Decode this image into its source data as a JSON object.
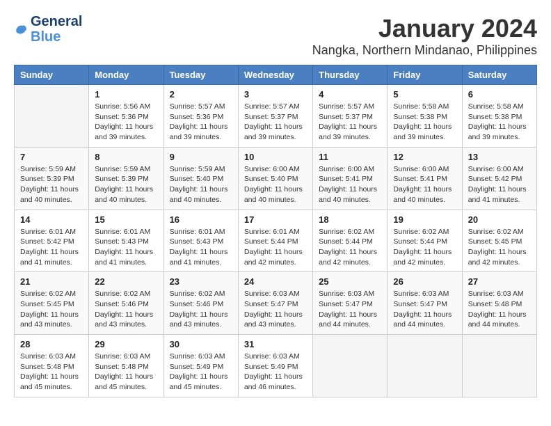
{
  "header": {
    "logo_line1": "General",
    "logo_line2": "Blue",
    "title": "January 2024",
    "subtitle": "Nangka, Northern Mindanao, Philippines"
  },
  "calendar": {
    "days_of_week": [
      "Sunday",
      "Monday",
      "Tuesday",
      "Wednesday",
      "Thursday",
      "Friday",
      "Saturday"
    ],
    "weeks": [
      [
        {
          "day": "",
          "info": ""
        },
        {
          "day": "1",
          "info": "Sunrise: 5:56 AM\nSunset: 5:36 PM\nDaylight: 11 hours\nand 39 minutes."
        },
        {
          "day": "2",
          "info": "Sunrise: 5:57 AM\nSunset: 5:36 PM\nDaylight: 11 hours\nand 39 minutes."
        },
        {
          "day": "3",
          "info": "Sunrise: 5:57 AM\nSunset: 5:37 PM\nDaylight: 11 hours\nand 39 minutes."
        },
        {
          "day": "4",
          "info": "Sunrise: 5:57 AM\nSunset: 5:37 PM\nDaylight: 11 hours\nand 39 minutes."
        },
        {
          "day": "5",
          "info": "Sunrise: 5:58 AM\nSunset: 5:38 PM\nDaylight: 11 hours\nand 39 minutes."
        },
        {
          "day": "6",
          "info": "Sunrise: 5:58 AM\nSunset: 5:38 PM\nDaylight: 11 hours\nand 39 minutes."
        }
      ],
      [
        {
          "day": "7",
          "info": "Sunrise: 5:59 AM\nSunset: 5:39 PM\nDaylight: 11 hours\nand 40 minutes."
        },
        {
          "day": "8",
          "info": "Sunrise: 5:59 AM\nSunset: 5:39 PM\nDaylight: 11 hours\nand 40 minutes."
        },
        {
          "day": "9",
          "info": "Sunrise: 5:59 AM\nSunset: 5:40 PM\nDaylight: 11 hours\nand 40 minutes."
        },
        {
          "day": "10",
          "info": "Sunrise: 6:00 AM\nSunset: 5:40 PM\nDaylight: 11 hours\nand 40 minutes."
        },
        {
          "day": "11",
          "info": "Sunrise: 6:00 AM\nSunset: 5:41 PM\nDaylight: 11 hours\nand 40 minutes."
        },
        {
          "day": "12",
          "info": "Sunrise: 6:00 AM\nSunset: 5:41 PM\nDaylight: 11 hours\nand 40 minutes."
        },
        {
          "day": "13",
          "info": "Sunrise: 6:00 AM\nSunset: 5:42 PM\nDaylight: 11 hours\nand 41 minutes."
        }
      ],
      [
        {
          "day": "14",
          "info": "Sunrise: 6:01 AM\nSunset: 5:42 PM\nDaylight: 11 hours\nand 41 minutes."
        },
        {
          "day": "15",
          "info": "Sunrise: 6:01 AM\nSunset: 5:43 PM\nDaylight: 11 hours\nand 41 minutes."
        },
        {
          "day": "16",
          "info": "Sunrise: 6:01 AM\nSunset: 5:43 PM\nDaylight: 11 hours\nand 41 minutes."
        },
        {
          "day": "17",
          "info": "Sunrise: 6:01 AM\nSunset: 5:44 PM\nDaylight: 11 hours\nand 42 minutes."
        },
        {
          "day": "18",
          "info": "Sunrise: 6:02 AM\nSunset: 5:44 PM\nDaylight: 11 hours\nand 42 minutes."
        },
        {
          "day": "19",
          "info": "Sunrise: 6:02 AM\nSunset: 5:44 PM\nDaylight: 11 hours\nand 42 minutes."
        },
        {
          "day": "20",
          "info": "Sunrise: 6:02 AM\nSunset: 5:45 PM\nDaylight: 11 hours\nand 42 minutes."
        }
      ],
      [
        {
          "day": "21",
          "info": "Sunrise: 6:02 AM\nSunset: 5:45 PM\nDaylight: 11 hours\nand 43 minutes."
        },
        {
          "day": "22",
          "info": "Sunrise: 6:02 AM\nSunset: 5:46 PM\nDaylight: 11 hours\nand 43 minutes."
        },
        {
          "day": "23",
          "info": "Sunrise: 6:02 AM\nSunset: 5:46 PM\nDaylight: 11 hours\nand 43 minutes."
        },
        {
          "day": "24",
          "info": "Sunrise: 6:03 AM\nSunset: 5:47 PM\nDaylight: 11 hours\nand 43 minutes."
        },
        {
          "day": "25",
          "info": "Sunrise: 6:03 AM\nSunset: 5:47 PM\nDaylight: 11 hours\nand 44 minutes."
        },
        {
          "day": "26",
          "info": "Sunrise: 6:03 AM\nSunset: 5:47 PM\nDaylight: 11 hours\nand 44 minutes."
        },
        {
          "day": "27",
          "info": "Sunrise: 6:03 AM\nSunset: 5:48 PM\nDaylight: 11 hours\nand 44 minutes."
        }
      ],
      [
        {
          "day": "28",
          "info": "Sunrise: 6:03 AM\nSunset: 5:48 PM\nDaylight: 11 hours\nand 45 minutes."
        },
        {
          "day": "29",
          "info": "Sunrise: 6:03 AM\nSunset: 5:48 PM\nDaylight: 11 hours\nand 45 minutes."
        },
        {
          "day": "30",
          "info": "Sunrise: 6:03 AM\nSunset: 5:49 PM\nDaylight: 11 hours\nand 45 minutes."
        },
        {
          "day": "31",
          "info": "Sunrise: 6:03 AM\nSunset: 5:49 PM\nDaylight: 11 hours\nand 46 minutes."
        },
        {
          "day": "",
          "info": ""
        },
        {
          "day": "",
          "info": ""
        },
        {
          "day": "",
          "info": ""
        }
      ]
    ]
  }
}
